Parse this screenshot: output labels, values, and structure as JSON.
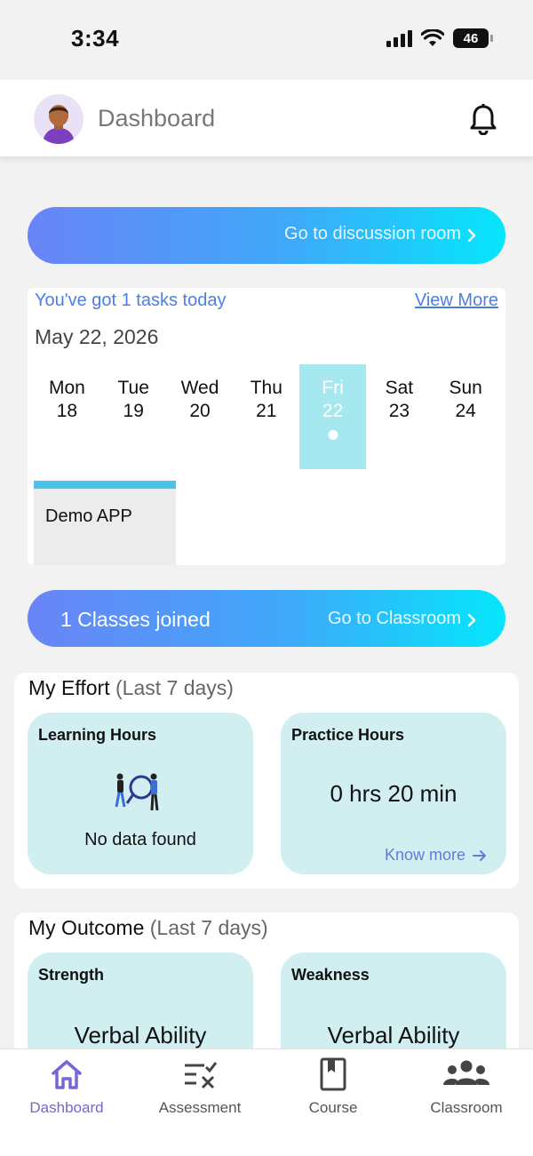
{
  "status_bar": {
    "time": "3:34",
    "battery": "46"
  },
  "header": {
    "title": "Dashboard",
    "avatar_icon": "user-avatar-icon",
    "notification_icon": "bell-icon"
  },
  "discussion": {
    "label": "Go to discussion room"
  },
  "tasks": {
    "summary": "You've got 1 tasks today",
    "view_more": "View More",
    "date": "May 22, 2026",
    "days": [
      {
        "name": "Mon",
        "num": "18"
      },
      {
        "name": "Tue",
        "num": "19"
      },
      {
        "name": "Wed",
        "num": "20"
      },
      {
        "name": "Thu",
        "num": "21"
      },
      {
        "name": "Fri",
        "num": "22"
      },
      {
        "name": "Sat",
        "num": "23"
      },
      {
        "name": "Sun",
        "num": "24"
      }
    ],
    "selected_day": "Fri",
    "event": "Demo APP"
  },
  "classes": {
    "count_text": "1 Classes joined",
    "link": "Go to Classroom"
  },
  "effort": {
    "title": "My Effort",
    "period": "(Last 7 days)",
    "learning": {
      "title": "Learning Hours",
      "empty": "No data found"
    },
    "practice": {
      "title": "Practice Hours",
      "value": "0 hrs 20 min",
      "link": "Know more"
    }
  },
  "outcome": {
    "title": "My Outcome",
    "period": "(Last 7 days)",
    "strength": {
      "title": "Strength",
      "value": "Verbal Ability"
    },
    "weakness": {
      "title": "Weakness",
      "value": "Verbal Ability"
    }
  },
  "nav": {
    "items": [
      {
        "label": "Dashboard",
        "icon": "home-icon",
        "active": true
      },
      {
        "label": "Assessment",
        "icon": "assessment-icon",
        "active": false
      },
      {
        "label": "Course",
        "icon": "book-icon",
        "active": false
      },
      {
        "label": "Classroom",
        "icon": "group-icon",
        "active": false
      }
    ]
  },
  "colors": {
    "accent": "#7966d6",
    "link": "#4c7ee6",
    "tile": "#d1eff1",
    "selected_day": "#a6e8ef"
  }
}
